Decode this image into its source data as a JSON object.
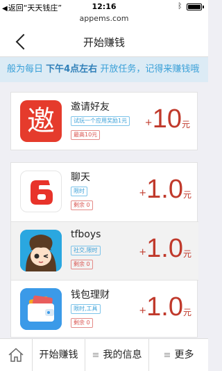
{
  "status_bar": {
    "back_label": "返回“天天钱庄”",
    "time": "12:16"
  },
  "url_bar": {
    "url": "appems.com"
  },
  "nav": {
    "title": "开始赚钱"
  },
  "notice": {
    "prefix": "般为每日 ",
    "highlight": "下午4点左右",
    "suffix": " 开放任务，记得来赚钱哦"
  },
  "featured": {
    "name": "邀请好友",
    "icon_char": "邀",
    "tag1": "试玩一个应用奖励1元",
    "tag2": "最高10元",
    "plus": "+",
    "amount": "10",
    "unit": "元"
  },
  "apps": [
    {
      "name": "聊天",
      "tag": "限时",
      "remain": "剩余 0",
      "plus": "+",
      "amount": "1.0",
      "unit": "元"
    },
    {
      "name": "tfboys",
      "tag": "社交,限时",
      "remain": "剩余 0",
      "plus": "+",
      "amount": "1.0",
      "unit": "元"
    },
    {
      "name": "钱包理财",
      "tag": "限时,工具",
      "remain": "剩余 0",
      "plus": "+",
      "amount": "1.0",
      "unit": "元"
    }
  ],
  "tabs": {
    "earn": "开始赚钱",
    "info": "我的信息",
    "more": "更多",
    "menu_glyph": "≡"
  },
  "colors": {
    "accent_red": "#c0392b",
    "notice_blue": "#3aa0d8",
    "notice_bg": "#dcebf5"
  }
}
